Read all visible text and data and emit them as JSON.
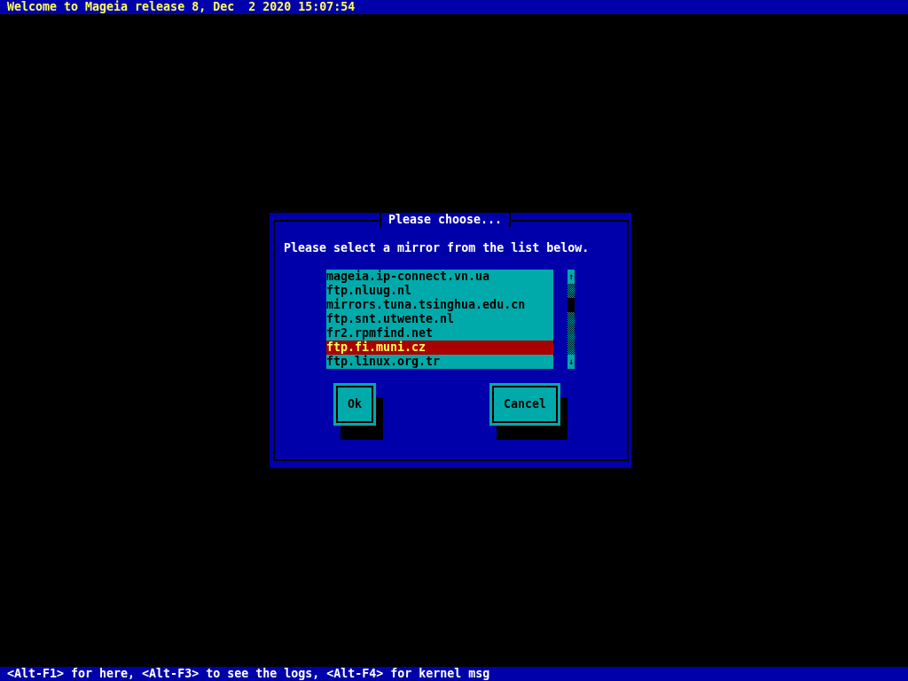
{
  "top_bar": {
    "text": "Welcome to Mageia release 8, Dec  2 2020 15:07:54"
  },
  "dialog": {
    "title": "Please choose...",
    "message": "Please select a mirror from the list below.",
    "mirrors": [
      {
        "label": "mageia.ip-connect.vn.ua",
        "selected": false
      },
      {
        "label": "ftp.nluug.nl",
        "selected": false
      },
      {
        "label": "mirrors.tuna.tsinghua.edu.cn",
        "selected": false
      },
      {
        "label": "ftp.snt.utwente.nl",
        "selected": false
      },
      {
        "label": "fr2.rpmfind.net",
        "selected": false
      },
      {
        "label": "ftp.fi.muni.cz",
        "selected": true
      },
      {
        "label": "ftp.linux.org.tr",
        "selected": false
      }
    ],
    "scroll_up": "↑",
    "scroll_down": "↓",
    "buttons": [
      "Ok",
      "Cancel"
    ]
  },
  "bottom_bar": {
    "text": "<Alt-F1> for here, <Alt-F3> to see the logs, <Alt-F4> for kernel msg"
  }
}
